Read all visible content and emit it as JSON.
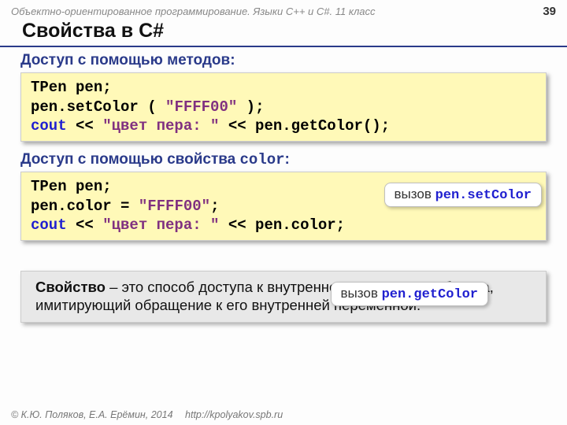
{
  "header": {
    "course": "Объектно-ориентированное программирование. Языки C++ и C#. 11 класс",
    "page": "39"
  },
  "title": "Свойства в C#",
  "section1": {
    "heading": "Доступ с помощью методов",
    "colon": ":",
    "code": {
      "l1a": "TPen pen;",
      "l2a": "pen.setColor",
      "l2b": "(",
      "l2c": " \"FFFF00\" ",
      "l2d": ");",
      "l3a": "cout",
      "l3b": " << ",
      "l3c": "\"цвет пера: \"",
      "l3d": " << pen.getColor();"
    }
  },
  "section2": {
    "heading_pre": "Доступ с помощью свойства ",
    "heading_mono": "color",
    "colon": ":",
    "code": {
      "l1a": "TPen pen;",
      "l2a": "pen.color",
      "l2b": " = ",
      "l2c": "\"FFFF00\"",
      "l2d": ";",
      "l3a": "cout",
      "l3b": " << ",
      "l3c": "\"цвет пера: \"",
      "l3d": " << pen.color;"
    }
  },
  "callout1": {
    "label": "вызов ",
    "code": "pen.setColor"
  },
  "callout2": {
    "label": "вызов ",
    "code": "pen.getColor"
  },
  "definition": {
    "term": "Свойство",
    "dash": " – ",
    "body": "это способ доступа к внутреннему состоянию объекта, имитирующий обращение к его внутренней переменной."
  },
  "footer": {
    "copyright": "© К.Ю. Поляков, Е.А. Ерёмин, 2014",
    "url": "http://kpolyakov.spb.ru"
  }
}
